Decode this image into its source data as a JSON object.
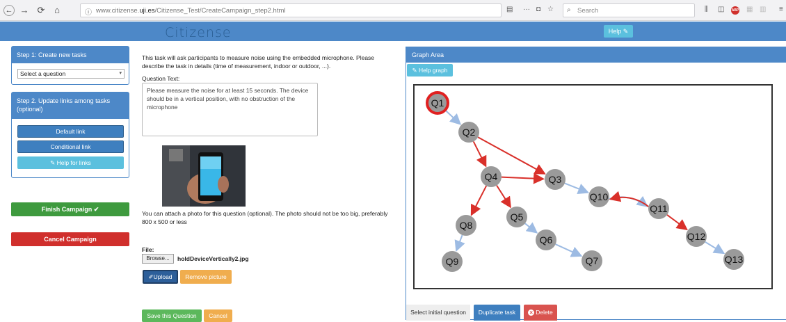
{
  "browser": {
    "url_prefix": "www.citizense.",
    "url_domain": "uji.es",
    "url_path": "/Citizense_Test/CreateCampaign_step2.html",
    "search_placeholder": "Search"
  },
  "header": {
    "brand": "Citizense",
    "help_label": "Help"
  },
  "step1": {
    "title": "Step 1: Create new tasks",
    "select_value": "Select a question"
  },
  "step2": {
    "title": "Step 2. Update links among tasks (optional)",
    "default_link": "Default link",
    "conditional_link": "Conditional link",
    "help_links": "Help for links"
  },
  "actions": {
    "finish": "Finish Campaign ✔",
    "cancel": "Cancel Campaign"
  },
  "task": {
    "description": "This task will ask participants to measure noise using the embedded microphone. Please describe the task in details (time of measurement, indoor or outdoor, ...).",
    "question_label": "Question Text:",
    "question_text": "Please measure the noise for at least 15 seconds. The device should be in a vertical position, with no obstruction of the microphone",
    "photo_note": "You can attach a photo for this question (optional). The photo should not be too big, preferably 800 x 500 or less",
    "file_label": "File:",
    "browse_label": "Browse...",
    "file_name": "holdDeviceVertically2.jpg",
    "upload_label": "Upload",
    "remove_label": "Remove picture",
    "save_label": "Save this Question",
    "cancel_label": "Cancel"
  },
  "graph": {
    "title": "Graph Area",
    "help_label": "Help graph",
    "select_initial": "Select initial question",
    "duplicate": "Duplicate task",
    "delete": "Delete",
    "colors": {
      "node": "#9a9a9a",
      "initial_border": "#e02020",
      "default_edge": "#9dbbe3",
      "conditional_edge": "#d9302a"
    },
    "nodes": [
      {
        "id": "Q1",
        "initial": true
      },
      {
        "id": "Q2"
      },
      {
        "id": "Q3"
      },
      {
        "id": "Q4"
      },
      {
        "id": "Q5"
      },
      {
        "id": "Q6"
      },
      {
        "id": "Q7"
      },
      {
        "id": "Q8"
      },
      {
        "id": "Q9"
      },
      {
        "id": "Q10"
      },
      {
        "id": "Q11"
      },
      {
        "id": "Q12"
      },
      {
        "id": "Q13"
      }
    ],
    "edges": [
      {
        "from": "Q1",
        "to": "Q2",
        "type": "default"
      },
      {
        "from": "Q2",
        "to": "Q4",
        "type": "conditional"
      },
      {
        "from": "Q2",
        "to": "Q3",
        "type": "conditional"
      },
      {
        "from": "Q4",
        "to": "Q3",
        "type": "conditional"
      },
      {
        "from": "Q4",
        "to": "Q8",
        "type": "conditional"
      },
      {
        "from": "Q4",
        "to": "Q5",
        "type": "conditional"
      },
      {
        "from": "Q3",
        "to": "Q10",
        "type": "default"
      },
      {
        "from": "Q10",
        "to": "Q11",
        "type": "default"
      },
      {
        "from": "Q11",
        "to": "Q10",
        "type": "conditional"
      },
      {
        "from": "Q11",
        "to": "Q12",
        "type": "conditional"
      },
      {
        "from": "Q12",
        "to": "Q13",
        "type": "default"
      },
      {
        "from": "Q5",
        "to": "Q6",
        "type": "default"
      },
      {
        "from": "Q6",
        "to": "Q7",
        "type": "default"
      },
      {
        "from": "Q8",
        "to": "Q9",
        "type": "default"
      }
    ]
  }
}
